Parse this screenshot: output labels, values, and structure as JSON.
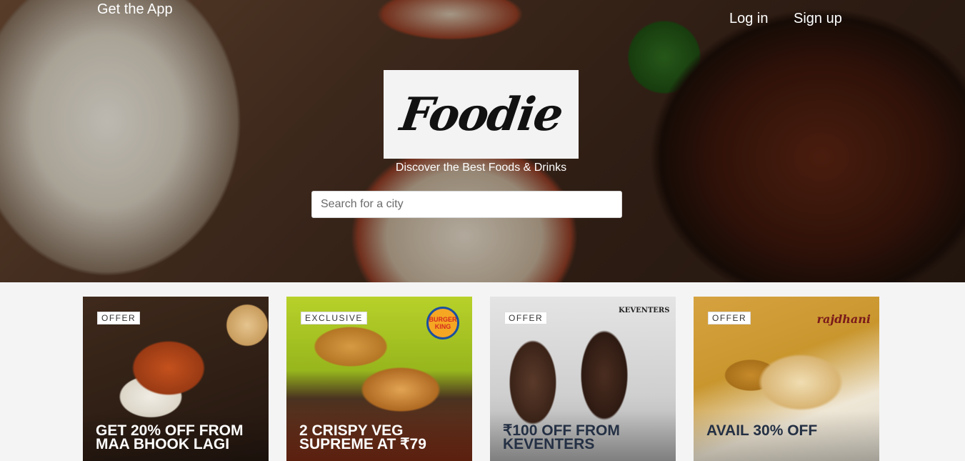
{
  "header": {
    "get_app": "Get the App",
    "login": "Log in",
    "signup": "Sign up"
  },
  "hero": {
    "logo_text": "Foodie",
    "tagline": "Discover the Best Foods & Drinks",
    "search_placeholder": "Search for a city"
  },
  "offers": [
    {
      "badge": "OFFER",
      "title": "GET 20% OFF FROM MAA BHOOK LAGI",
      "brand": ""
    },
    {
      "badge": "EXCLUSIVE",
      "title": "2 CRISPY VEG SUPREME AT ₹79",
      "brand": "BURGER KING"
    },
    {
      "badge": "OFFER",
      "title": "₹100 OFF FROM KEVENTERS",
      "brand": "KEVENTERS"
    },
    {
      "badge": "OFFER",
      "title": "AVAIL 30% OFF",
      "brand": "rajdhani"
    }
  ],
  "colors": {
    "page_bg": "#f4f4f4",
    "text_light": "#ffffff",
    "card_title_dark": "#243044"
  }
}
